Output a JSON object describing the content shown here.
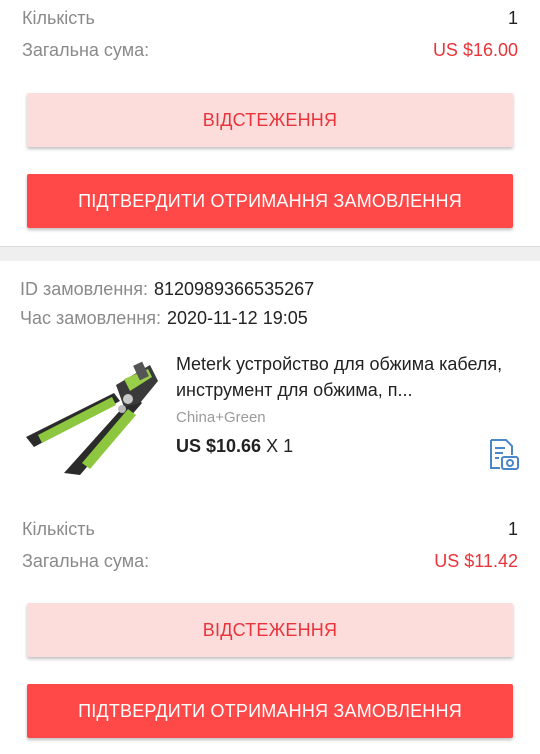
{
  "order1": {
    "quantity_label": "Кількість",
    "quantity_value": "1",
    "total_label": "Загальна сума:",
    "total_value": "US $16.00",
    "track_label": "ВІДСТЕЖЕННЯ",
    "confirm_label": "ПІДТВЕРДИТИ ОТРИМАННЯ ЗАМОВЛЕННЯ"
  },
  "order2": {
    "id_label": "ID замовлення:",
    "id_value": "8120989366535267",
    "time_label": "Час замовлення:",
    "time_value": "2020-11-12 19:05",
    "product": {
      "title": "Meterk устройство для обжима кабеля, инструмент для обжима, п...",
      "variant": "China+Green",
      "price": "US $10.66",
      "qty": "X 1",
      "action_icon": "photo-review-icon"
    },
    "quantity_label": "Кількість",
    "quantity_value": "1",
    "total_label": "Загальна сума:",
    "total_value": "US $11.42",
    "track_label": "ВІДСТЕЖЕННЯ",
    "confirm_label": "ПІДТВЕРДИТИ ОТРИМАННЯ ЗАМОВЛЕННЯ"
  },
  "colors": {
    "accent_red": "#ff4848",
    "price_red": "#e8343a",
    "track_bg": "#fddcdc",
    "icon_blue": "#4a86c8"
  }
}
